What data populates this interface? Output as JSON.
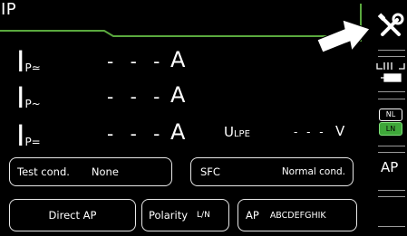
{
  "header": {
    "title": "IP"
  },
  "measurements": [
    {
      "symbol_main": "I",
      "symbol_sub": "P≃",
      "value": "- - -",
      "unit": "A"
    },
    {
      "symbol_main": "I",
      "symbol_sub": "P~",
      "value": "- - -",
      "unit": "A"
    },
    {
      "symbol_main": "I",
      "symbol_sub": "P=",
      "value": "- - -",
      "unit": "A"
    }
  ],
  "voltage": {
    "symbol_main": "U",
    "symbol_sub": "LPE",
    "value": "- - -",
    "unit": "V"
  },
  "settings": {
    "test_cond": {
      "label": "Test cond.",
      "value": "None"
    },
    "sfc": {
      "label": "SFC",
      "value": "Normal cond."
    },
    "direct_ap": {
      "label": "Direct AP"
    },
    "polarity": {
      "label": "Polarity",
      "value": "L/N"
    },
    "ap": {
      "label": "AP",
      "value": "ABCDEFGHIK"
    }
  },
  "sidebar": {
    "nl_label": "NL",
    "ln_label": "LN",
    "ap_label": "AP",
    "icons": [
      "tools-icon",
      "connector-icon"
    ]
  },
  "colors": {
    "accent_green": "#4caf3f",
    "ln_green": "#3fa83a"
  }
}
